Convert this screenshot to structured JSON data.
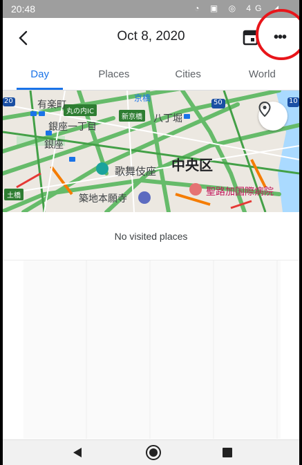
{
  "status_bar": {
    "time": "20:48",
    "network": "4G"
  },
  "app_bar": {
    "title": "Oct 8, 2020"
  },
  "tabs": [
    {
      "label": "Day",
      "active": true
    },
    {
      "label": "Places",
      "active": false
    },
    {
      "label": "Cities",
      "active": false
    },
    {
      "label": "World",
      "active": false
    }
  ],
  "map": {
    "labels": {
      "yurakucho": "有楽町",
      "ginza_1": "銀座一丁目",
      "ginza": "銀座",
      "kyobashi": "京橋",
      "hatchobori": "八丁堀",
      "kabukiza": "歌舞伎座",
      "chuo_ku": "中央区",
      "hospital": "聖路加国際病院",
      "tsukiji": "築地本願寺",
      "shinbashi_chip": "新京橋",
      "marunouchi_chip": "丸の内IC",
      "tsuchihashi_chip": "土橋",
      "route_50": "50",
      "route_10": "10",
      "route_20": "20"
    }
  },
  "content": {
    "empty_message": "No visited places"
  },
  "colors": {
    "accent": "#1a73e8",
    "highlight_ring": "#e8151a",
    "status_bar": "#9e9e9e"
  }
}
